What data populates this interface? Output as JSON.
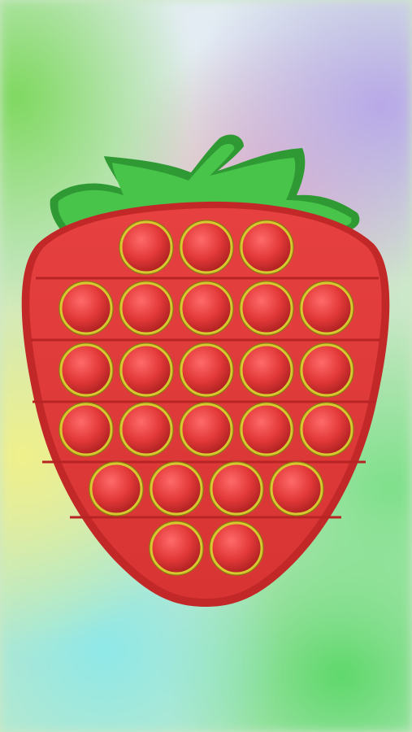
{
  "game": {
    "toy": "strawberry-pop-it",
    "rows": [
      3,
      5,
      5,
      5,
      4,
      2
    ],
    "bubble_count": 24,
    "popped": []
  },
  "colors": {
    "body": "#e03a3a",
    "body_edge": "#c42a2a",
    "bubble_ring": "#d8c830",
    "leaf": "#3fbf3f",
    "leaf_edge": "#1f8f2a"
  }
}
